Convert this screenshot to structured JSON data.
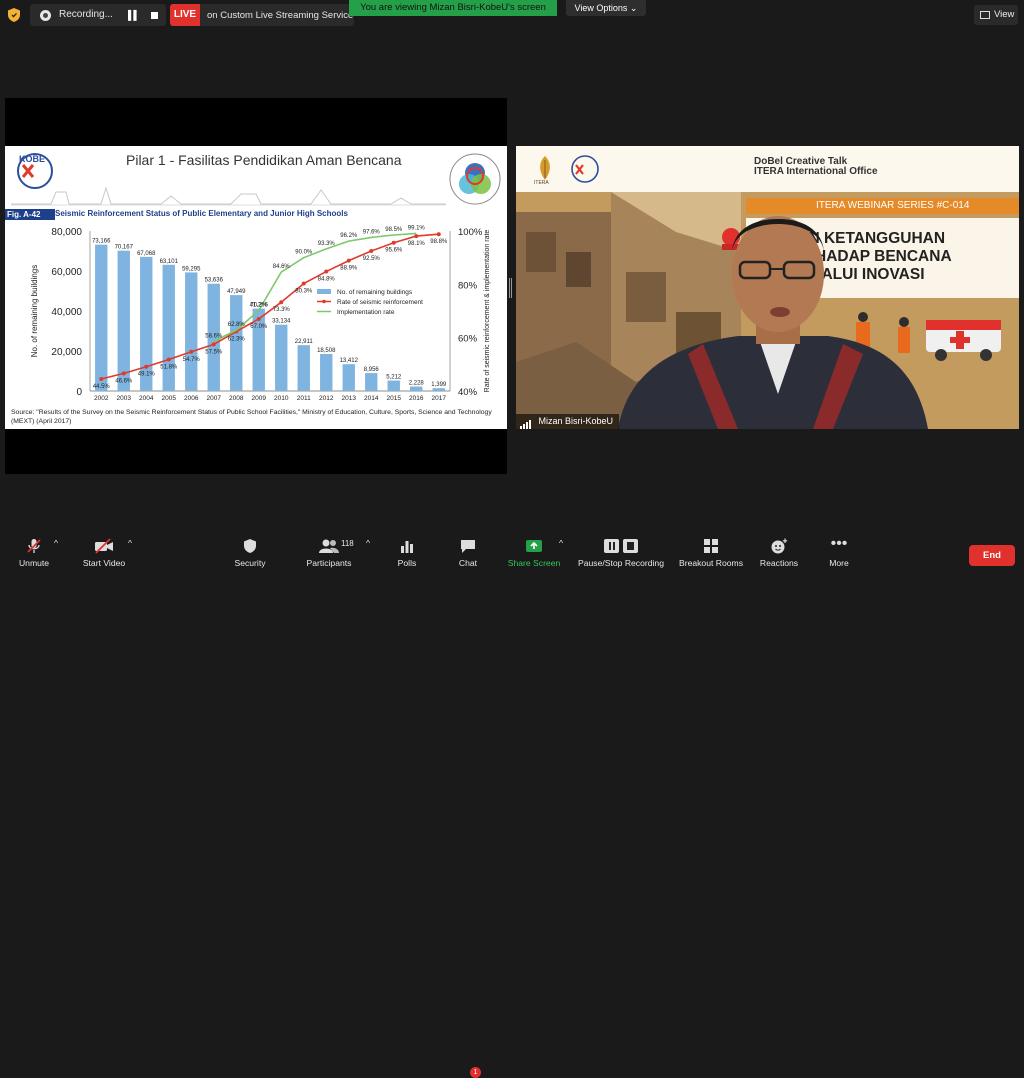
{
  "topbar": {
    "recording_label": "Recording...",
    "live_badge": "LIVE",
    "live_text": "on Custom Live Streaming Service",
    "viewing_banner": "You are viewing Mizan Bisri-KobeU's screen",
    "view_options": "View Options",
    "view_label": "View"
  },
  "slide": {
    "title": "Pilar 1 - Fasilitas Pendidikan Aman Bencana",
    "logo_text": "KOBE",
    "figure_tag": "Fig. A-42",
    "figure_title": "Seismic Reinforcement Status of Public Elementary and Junior High Schools",
    "source": "Source: \"Results of the Survey on the Seismic Reinforcement Status of Public School Facilities,\" Ministry of Education, Culture, Sports, Science and Technology (MEXT) (April 2017)"
  },
  "chart_data": {
    "type": "bar",
    "categories": [
      "2002",
      "2003",
      "2004",
      "2005",
      "2006",
      "2007",
      "2008",
      "2009",
      "2010",
      "2011",
      "2012",
      "2013",
      "2014",
      "2015",
      "2016",
      "2017"
    ],
    "ylabel": "No. of remaining buildings",
    "y2label": "Rate of seismic reinforcement & implementation rate",
    "ylim": [
      0,
      80000
    ],
    "y2lim": [
      40,
      100
    ],
    "yticks": [
      "0",
      "20,000",
      "40,000",
      "60,000",
      "80,000"
    ],
    "y2ticks": [
      "40%",
      "60%",
      "80%",
      "100%"
    ],
    "legend_position": "center-right",
    "series": [
      {
        "name": "No. of remaining buildings",
        "kind": "bar",
        "color": "#7fb4e0",
        "values": [
          73166,
          70167,
          67068,
          63101,
          59295,
          53636,
          47949,
          41206,
          33134,
          22911,
          18508,
          13412,
          8956,
          5212,
          2228,
          1399
        ],
        "labels": [
          "73,166",
          "70,167",
          "67,068",
          "63,101",
          "59,295",
          "53,636",
          "47,949",
          "41,206",
          "33,134",
          "22,911",
          "18,508",
          "13,412",
          "8,956",
          "5,212",
          "2,228",
          "1,399"
        ]
      },
      {
        "name": "Rate of seismic reinforcement",
        "kind": "line",
        "color": "#e03a2b",
        "values": [
          44.5,
          46.6,
          49.1,
          51.8,
          54.7,
          57.5,
          62.3,
          67.0,
          73.3,
          80.3,
          84.8,
          88.9,
          92.5,
          95.6,
          98.1,
          98.8
        ],
        "labels": [
          "44.5%",
          "46.6%",
          "49.1%",
          "51.8%",
          "54.7%",
          "57.5%",
          "62.3%",
          "67.0%",
          "73.3%",
          "80.3%",
          "84.8%",
          "88.9%",
          "92.5%",
          "95.6%",
          "98.1%",
          "98.8%"
        ]
      },
      {
        "name": "Implementation rate",
        "kind": "line",
        "color": "#7cc96a",
        "start_index": 5,
        "values": [
          58.6,
          62.8,
          70.2,
          84.6,
          90.0,
          93.3,
          96.2,
          97.6,
          98.5,
          99.1
        ],
        "labels": [
          "58.6%",
          "62.8%",
          "70.2%",
          "84.6%",
          "90.0%",
          "93.3%",
          "96.2%",
          "97.6%",
          "98.5%",
          "99.1%"
        ]
      }
    ]
  },
  "speaker": {
    "banner_line1": "DoBel Creative Talk",
    "banner_line2": "ITERA International Office",
    "itera_label": "ITERA",
    "webinar_series": "ITERA WEBINAR SERIES #C-014",
    "hero_line1": "NGUN KETANGGUHAN",
    "hero_line2": "TERHADAP BENCANA",
    "hero_line3": "LALUI INOVASI",
    "name": "Mizan Bisri-KobeU"
  },
  "toolbar": {
    "unmute": "Unmute",
    "start_video": "Start Video",
    "security": "Security",
    "participants": "Participants",
    "participants_count": "118",
    "polls": "Polls",
    "chat": "Chat",
    "chat_badge": "1",
    "share_screen": "Share Screen",
    "pause_recording": "Pause/Stop Recording",
    "breakout_rooms": "Breakout Rooms",
    "reactions": "Reactions",
    "more": "More",
    "end": "End"
  },
  "colors": {
    "accent_green": "#24a148",
    "end_red": "#e0312d",
    "bar_blue": "#7fb4e0"
  }
}
